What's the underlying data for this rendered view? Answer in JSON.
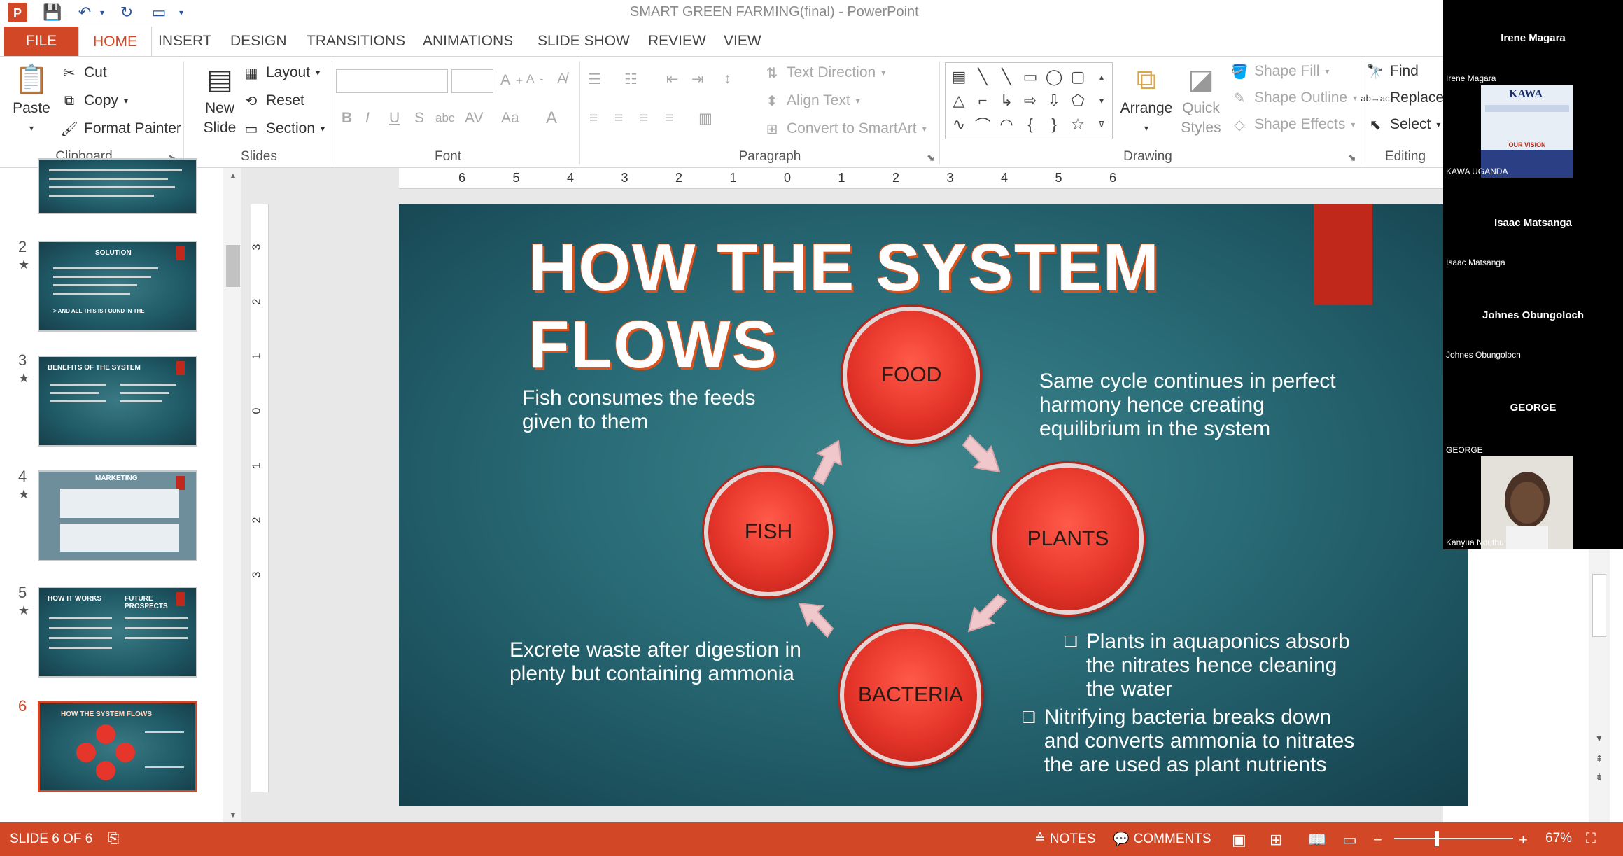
{
  "app": {
    "title": "SMART GREEN FARMING(final) - PowerPoint"
  },
  "tabs": {
    "file": "FILE",
    "items": [
      "HOME",
      "INSERT",
      "DESIGN",
      "TRANSITIONS",
      "ANIMATIONS",
      "SLIDE SHOW",
      "REVIEW",
      "VIEW"
    ]
  },
  "ribbon": {
    "clipboard": {
      "paste": "Paste",
      "cut": "Cut",
      "copy": "Copy",
      "format_painter": "Format Painter",
      "label": "Clipboard"
    },
    "slides": {
      "new_slide_1": "New",
      "new_slide_2": "Slide",
      "layout": "Layout",
      "reset": "Reset",
      "section": "Section",
      "label": "Slides"
    },
    "font": {
      "label": "Font"
    },
    "paragraph": {
      "text_direction": "Text Direction",
      "align_text": "Align Text",
      "convert_smartart": "Convert to SmartArt",
      "label": "Paragraph"
    },
    "drawing": {
      "arrange": "Arrange",
      "quick_styles_1": "Quick",
      "quick_styles_2": "Styles",
      "shape_fill": "Shape Fill",
      "shape_outline": "Shape Outline",
      "shape_effects": "Shape Effects",
      "label": "Drawing"
    },
    "editing": {
      "find": "Find",
      "replace": "Replace",
      "select": "Select",
      "label": "Editing"
    }
  },
  "ruler": {
    "h": [
      "6",
      "5",
      "4",
      "3",
      "2",
      "1",
      "0",
      "1",
      "2",
      "3",
      "4",
      "5",
      "6"
    ],
    "v": [
      "3",
      "2",
      "1",
      "0",
      "1",
      "2",
      "3"
    ]
  },
  "thumbnails": [
    {
      "num": "",
      "title": ""
    },
    {
      "num": "2",
      "title": "SOLUTION",
      "footer": "> AND ALL THIS IS FOUND IN THE"
    },
    {
      "num": "3",
      "title": "BENEFITS OF THE SYSTEM"
    },
    {
      "num": "4",
      "title": "MARKETING"
    },
    {
      "num": "5",
      "title": "HOW IT WORKS",
      "title2": "FUTURE PROSPECTS"
    },
    {
      "num": "6",
      "title": "HOW THE SYSTEM FLOWS"
    }
  ],
  "slide": {
    "title": "HOW THE SYSTEM FLOWS",
    "nodes": {
      "food": "FOOD",
      "fish": "FISH",
      "plants": "PLANTS",
      "bacteria": "BACTERIA"
    },
    "text_fish": "Fish consumes the feeds given to them",
    "text_cycle": "Same cycle continues in perfect harmony hence creating equilibrium in the system",
    "text_waste": "Excrete waste after digestion in plenty but containing ammonia",
    "bullet_plants": "Plants in aquaponics absorb the nitrates hence cleaning the water",
    "bullet_bacteria": "Nitrifying bacteria breaks down and converts ammonia to nitrates the are used as plant nutrients"
  },
  "participants": [
    {
      "name": "Irene Magara",
      "sub": "Irene Magara"
    },
    {
      "name": "",
      "sub": "KAWA UGANDA"
    },
    {
      "name": "Isaac Matsanga",
      "sub": "Isaac Matsanga"
    },
    {
      "name": "Johnes Obungoloch",
      "sub": "Johnes Obungoloch"
    },
    {
      "name": "GEORGE",
      "sub": "GEORGE"
    },
    {
      "name": "",
      "sub": "Kanyua Nduthu"
    }
  ],
  "kawa_card": {
    "brand": "KAWA",
    "heading": "OUR VISION"
  },
  "status": {
    "slide_of": "SLIDE 6 OF 6",
    "notes": "NOTES",
    "comments": "COMMENTS",
    "zoom": "67%"
  },
  "colors": {
    "accent": "#d24726",
    "slide_bg": "#2a6d78",
    "node_red": "#e6352a"
  }
}
